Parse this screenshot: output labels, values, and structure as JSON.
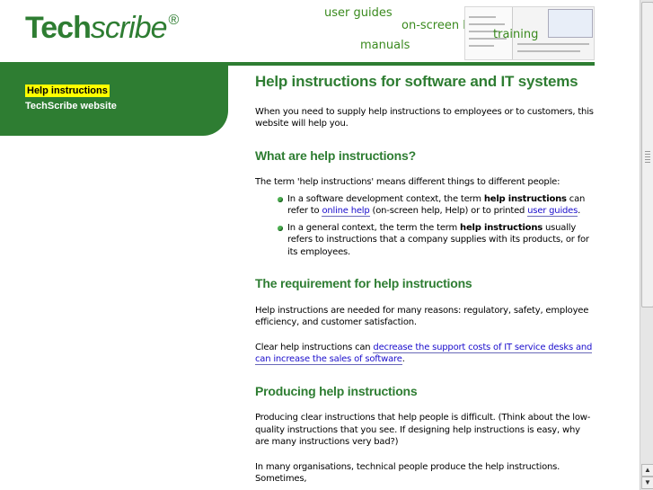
{
  "logo": {
    "tech": "Tech",
    "scribe": "scribe",
    "reg": "®"
  },
  "topnav": {
    "user_guides": "user guides",
    "onscreen_help": "on-screen help",
    "training": "training",
    "manuals": "manuals"
  },
  "sidebar": {
    "active_item": "Help instructions",
    "website_item": "TechScribe website"
  },
  "colors": {
    "brand_green": "#2e7d32",
    "highlight": "#ffff00",
    "link": "#1a0dcc"
  },
  "content": {
    "title": "Help instructions for software and IT systems",
    "intro": "When you need to supply help instructions to employees or to customers, this website will help you.",
    "s1": {
      "heading": "What are help instructions?",
      "lead": "The term 'help instructions' means different things to different people:",
      "b1_pre": "In a software development context, the term ",
      "b1_bold": "help instructions",
      "b1_mid": " can refer to ",
      "b1_link1": "online help",
      "b1_mid2": " (on-screen help, Help) or to printed ",
      "b1_link2": "user guides",
      "b1_end": ".",
      "b2_pre": "In a general context, the term the term ",
      "b2_bold": "help instructions",
      "b2_end": " usually refers to instructions that a company supplies with its products, or for its employees."
    },
    "s2": {
      "heading": "The requirement for help instructions",
      "p1": "Help instructions are needed for many reasons: regulatory, safety, employee efficiency, and customer satisfaction.",
      "p2_pre": "Clear help instructions can ",
      "p2_link": "decrease the support costs of IT service desks and can increase the sales of software",
      "p2_end": "."
    },
    "s3": {
      "heading": "Producing help instructions",
      "p1": "Producing clear instructions that help people is difficult. (Think about the low-quality instructions that you see. If designing help instructions is easy, why are many instructions very bad?)",
      "p2": "In many organisations, technical people produce the help instructions. Sometimes,"
    }
  }
}
